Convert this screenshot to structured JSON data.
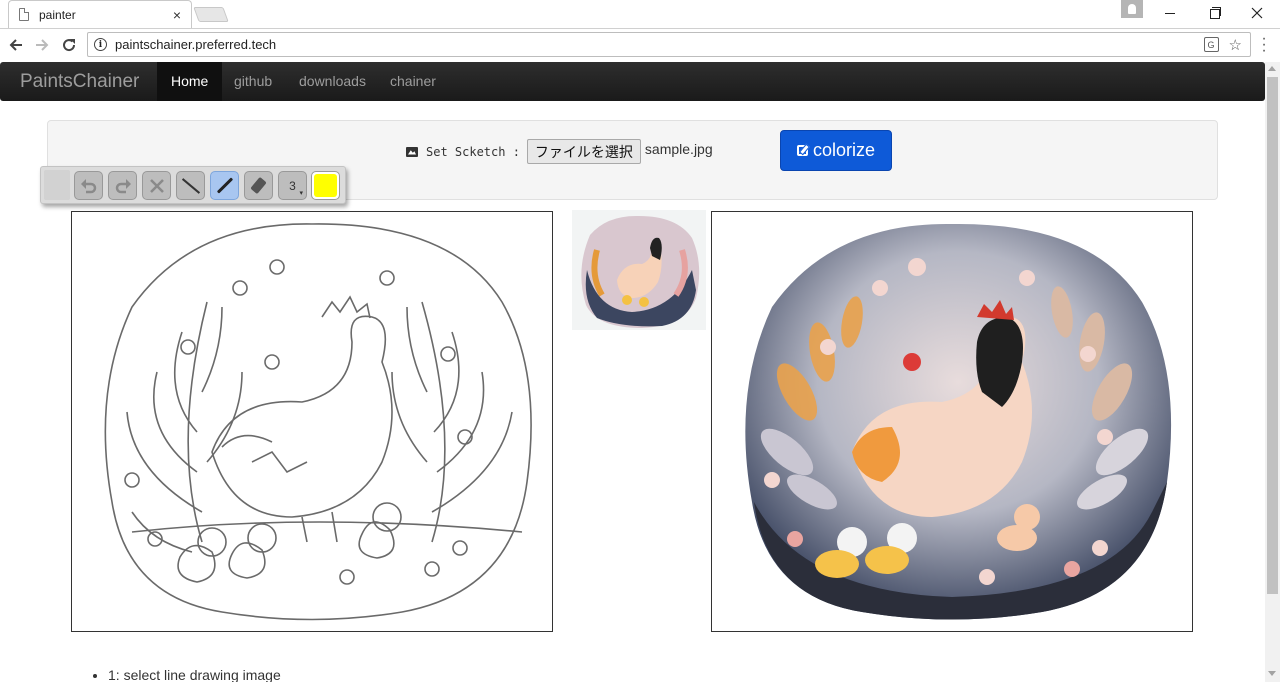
{
  "browser": {
    "tab_title": "painter",
    "tab_close": "×",
    "url": "paintschainer.preferred.tech",
    "icons": [
      "page-icon",
      "close-icon",
      "back-icon",
      "forward-icon",
      "reload-icon",
      "info-icon",
      "translate-icon",
      "star-icon",
      "menu-icon",
      "profile-icon",
      "minimize-icon",
      "maximize-icon",
      "close-window-icon"
    ]
  },
  "navbar": {
    "brand": "PaintsChainer",
    "items": [
      {
        "label": "Home",
        "active": true
      },
      {
        "label": "github"
      },
      {
        "label": "downloads"
      },
      {
        "label": "chainer"
      }
    ]
  },
  "panel": {
    "sketch_label": "Set Scketch :",
    "file_button": "ファイルを選択",
    "file_name": "sample.jpg",
    "colorize_label": "colorize"
  },
  "palette": {
    "tools": [
      "undo-icon",
      "redo-icon",
      "clear-icon",
      "line-icon",
      "pen-icon",
      "eraser-icon"
    ],
    "active_tool": "pen-icon",
    "brush_size": "3",
    "color": "#ffff00"
  },
  "steps": [
    "1: select line drawing image"
  ],
  "colors": {
    "navbar_bg": "#222222",
    "colorize_button": "#0e5ad8",
    "panel_bg": "#f5f5f5"
  }
}
